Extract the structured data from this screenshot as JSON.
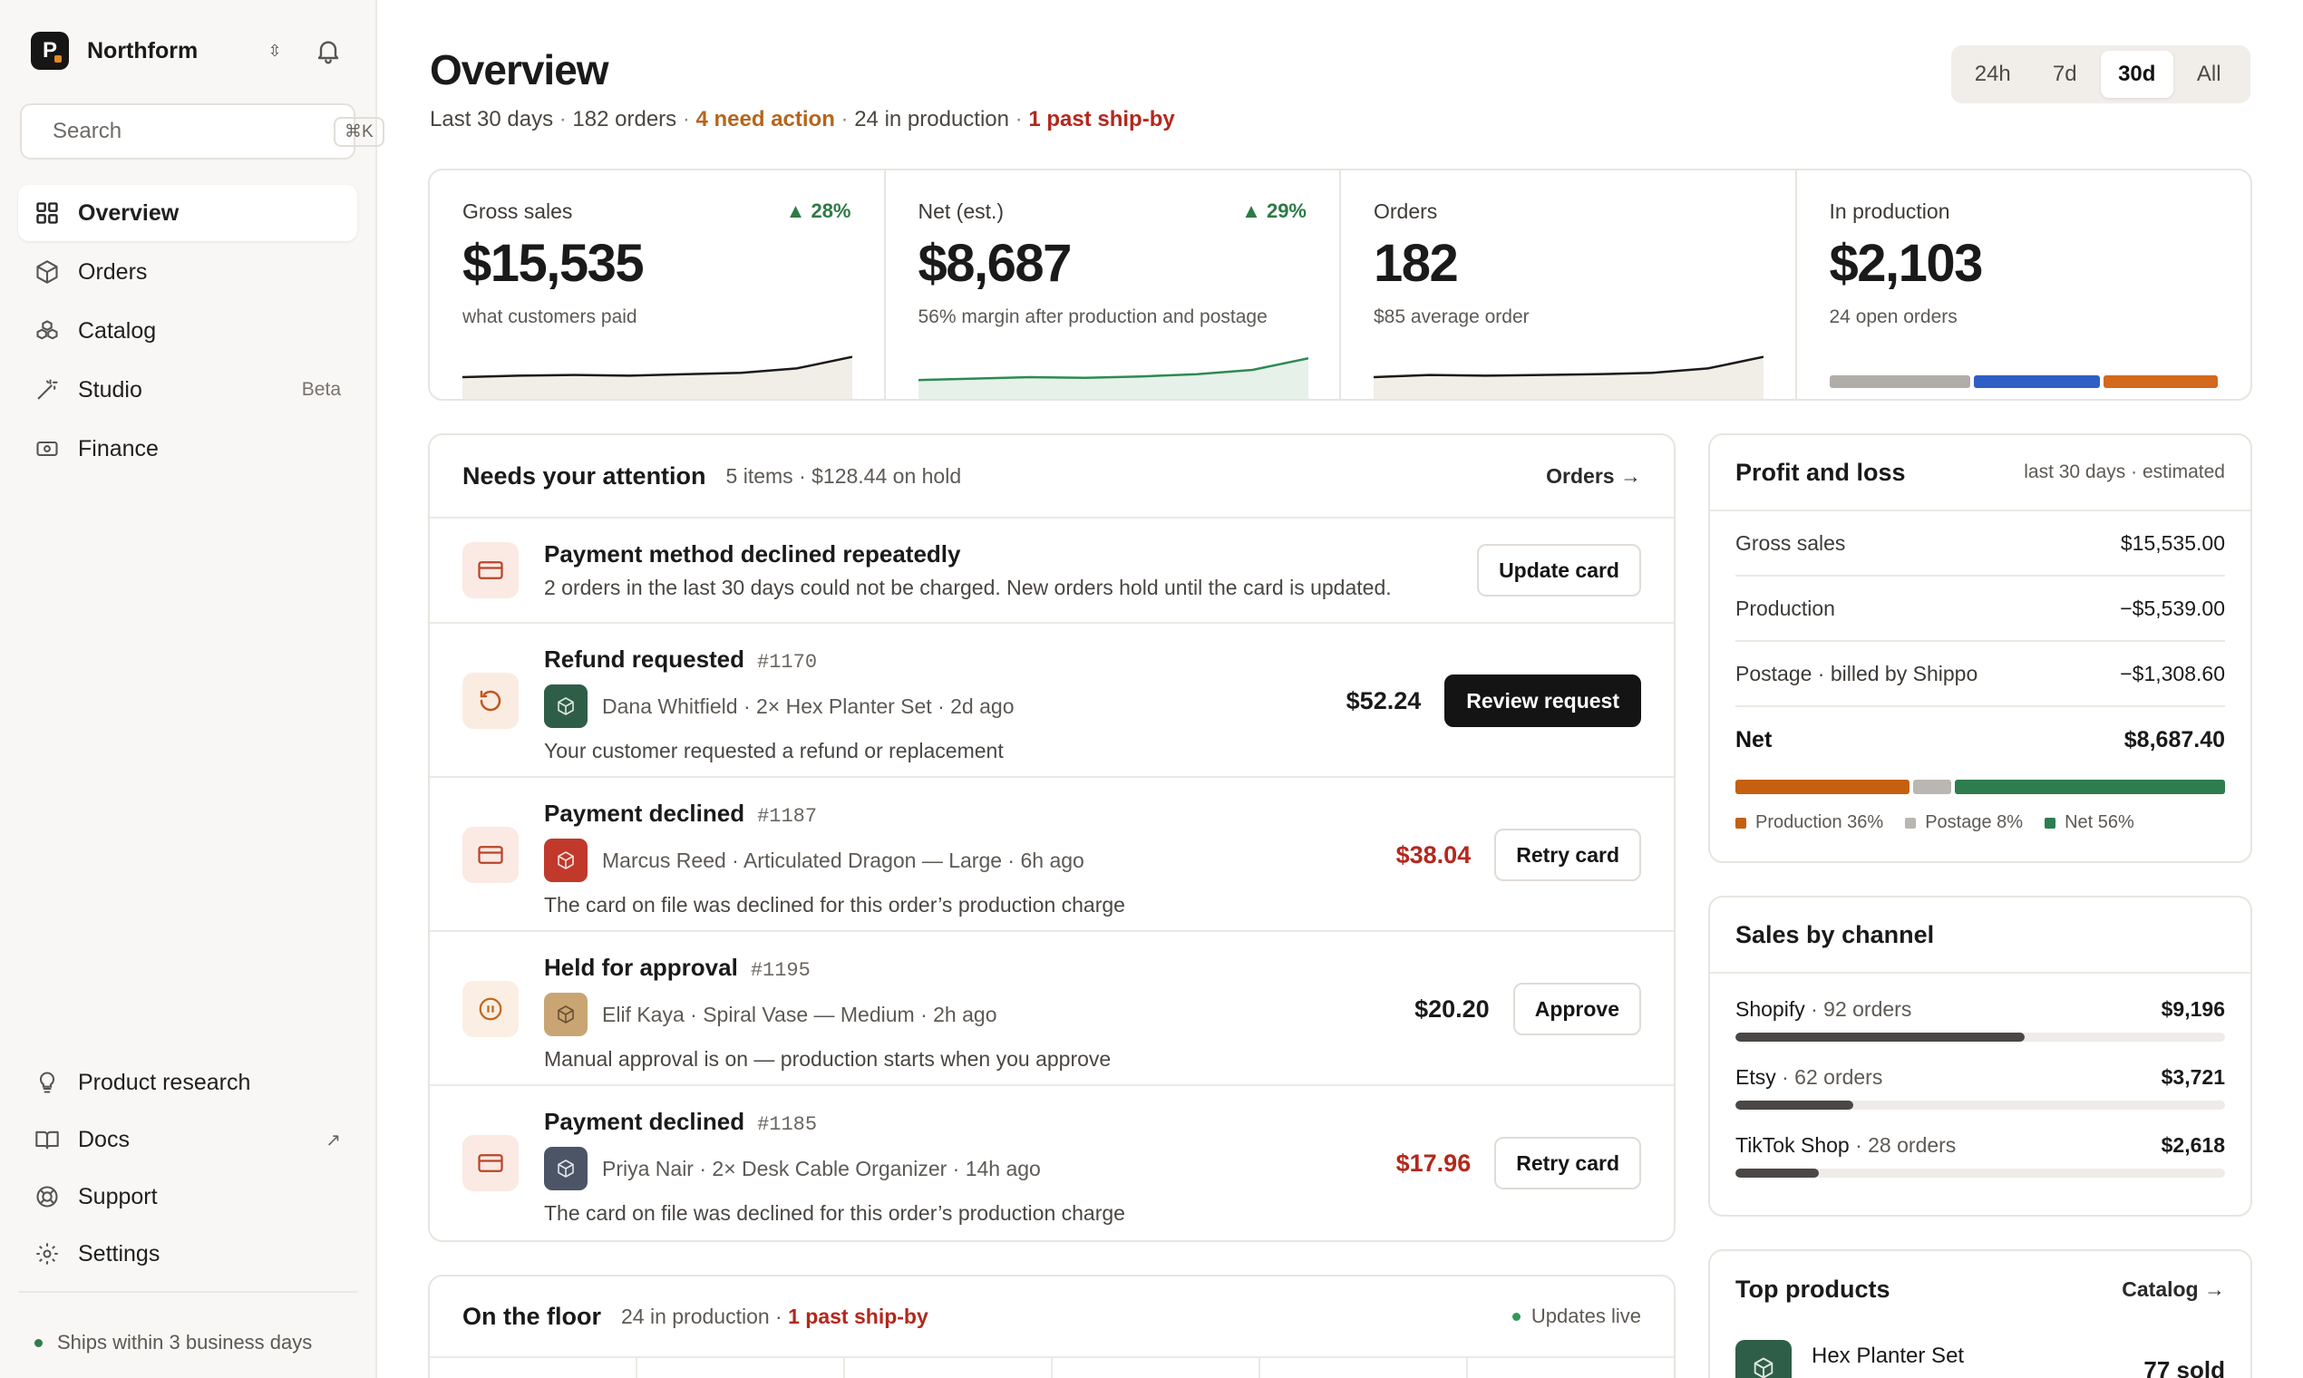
{
  "brand": {
    "name": "Northform",
    "logo_letter": "P"
  },
  "search": {
    "placeholder": "Search",
    "shortcut": "⌘K"
  },
  "nav": [
    {
      "label": "Overview",
      "icon": "grid-icon",
      "active": true
    },
    {
      "label": "Orders",
      "icon": "box-icon"
    },
    {
      "label": "Catalog",
      "icon": "cubes-icon"
    },
    {
      "label": "Studio",
      "icon": "magic-wand-icon",
      "badge": "Beta"
    },
    {
      "label": "Finance",
      "icon": "banknote-icon"
    }
  ],
  "nav_bottom": [
    {
      "label": "Product research",
      "icon": "lightbulb-icon"
    },
    {
      "label": "Docs",
      "icon": "book-icon",
      "external": "↗"
    },
    {
      "label": "Support",
      "icon": "lifebuoy-icon"
    },
    {
      "label": "Settings",
      "icon": "gear-icon"
    }
  ],
  "footer": {
    "ships": "Ships within 3 business days"
  },
  "header": {
    "title": "Overview",
    "sub": {
      "period": "Last 30 days",
      "orders": "182 orders",
      "action": "4 need action",
      "production": "24 in production",
      "past": "1 past ship-by"
    }
  },
  "range": {
    "options": [
      "24h",
      "7d",
      "30d",
      "All"
    ],
    "selected": "30d"
  },
  "stats": [
    {
      "label": "Gross sales",
      "delta": "▲ 28%",
      "value": "$15,535",
      "sub": "what customers paid",
      "spark": [
        0.3,
        0.32,
        0.33,
        0.32,
        0.34,
        0.36,
        0.42,
        0.58
      ]
    },
    {
      "label": "Net (est.)",
      "delta": "▲ 29%",
      "value": "$8,687",
      "sub": "56% margin after production and postage",
      "spark": [
        0.26,
        0.28,
        0.3,
        0.29,
        0.31,
        0.34,
        0.4,
        0.56
      ]
    },
    {
      "label": "Orders",
      "value": "182",
      "sub": "$85 average order",
      "spark": [
        0.3,
        0.33,
        0.32,
        0.33,
        0.34,
        0.36,
        0.42,
        0.58
      ]
    },
    {
      "label": "In production",
      "value": "$2,103",
      "sub": "24 open orders",
      "segments": [
        {
          "share": 0.37,
          "color": "#b0ada9"
        },
        {
          "share": 0.33,
          "color": "#2f5fc4"
        },
        {
          "share": 0.3,
          "color": "#d4681c"
        }
      ]
    }
  ],
  "attention": {
    "title": "Needs your attention",
    "meta": "5 items · $128.44 on hold",
    "link": "Orders →",
    "items": [
      {
        "title": "Payment method declined repeatedly",
        "desc": "2 orders in the last 30 days could not be charged. New orders hold until the card is updated.",
        "button": "Update card",
        "icon": "credit-card-icon"
      },
      {
        "title": "Refund requested",
        "num": "#1170",
        "meta": "Dana Whitfield · 2× Hex Planter Set · 2d ago",
        "note": "Your customer requested a refund or replacement",
        "amount": "$52.24",
        "button": "Review request",
        "icon": "refund-icon",
        "thumb": "#2f5e48"
      },
      {
        "title": "Payment declined",
        "num": "#1187",
        "meta": "Marcus Reed · Articulated Dragon — Large · 6h ago",
        "note": "The card on file was declined for this order’s production charge",
        "amount": "$38.04",
        "button": "Retry card",
        "icon": "credit-card-icon",
        "thumb": "#c0392b"
      },
      {
        "title": "Held for approval",
        "num": "#1195",
        "meta": "Elif Kaya · Spiral Vase — Medium · 2h ago",
        "note": "Manual approval is on — production starts when you approve",
        "amount": "$20.20",
        "button": "Approve",
        "icon": "pause-icon",
        "thumb": "#c9a574"
      },
      {
        "title": "Payment declined",
        "num": "#1185",
        "meta": "Priya Nair · 2× Desk Cable Organizer · 14h ago",
        "note": "The card on file was declined for this order’s production charge",
        "amount": "$17.96",
        "button": "Retry card",
        "icon": "credit-card-icon",
        "thumb": "#4b5566"
      }
    ]
  },
  "floor": {
    "title": "On the floor",
    "meta": "24 in production ·",
    "past": "1 past ship-by",
    "live": "Updates live"
  },
  "pnl": {
    "title": "Profit and loss",
    "meta": "last 30 days · estimated",
    "rows": [
      {
        "label": "Gross sales",
        "value": "$15,535.00"
      },
      {
        "label": "Production",
        "value": "−$5,539.00"
      },
      {
        "label": "Postage · billed by Shippo",
        "value": "−$1,308.60"
      },
      {
        "label": "Net",
        "value": "$8,687.40"
      }
    ],
    "legend": [
      {
        "label": "Production 36%",
        "share": 0.36,
        "color": "#c4600f"
      },
      {
        "label": "Postage 8%",
        "share": 0.08,
        "color": "#bab6b1"
      },
      {
        "label": "Net 56%",
        "share": 0.56,
        "color": "#2d7d4e"
      }
    ]
  },
  "channels": {
    "title": "Sales by channel",
    "items": [
      {
        "name": "Shopify",
        "count": "· 92 orders",
        "value": "$9,196",
        "share": 0.59
      },
      {
        "name": "Etsy",
        "count": "· 62 orders",
        "value": "$3,721",
        "share": 0.24
      },
      {
        "name": "TikTok Shop",
        "count": "· 28 orders",
        "value": "$2,618",
        "share": 0.17
      }
    ]
  },
  "top_products": {
    "title": "Top products",
    "link": "Catalog →",
    "items": [
      {
        "name": "Hex Planter Set",
        "sold": "77 sold"
      }
    ]
  }
}
